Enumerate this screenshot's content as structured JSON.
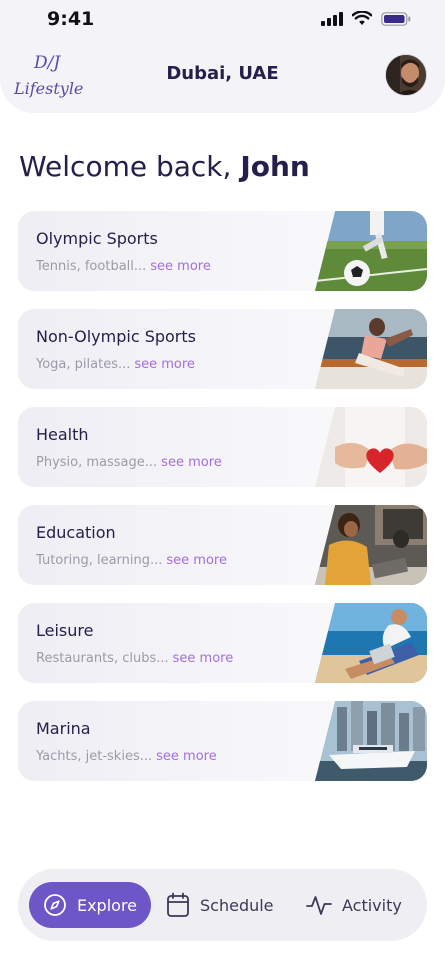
{
  "status": {
    "time": "9:41"
  },
  "header": {
    "logo_text_top": "D/J",
    "logo_text": "Lifestyle",
    "location": "Dubai, UAE"
  },
  "welcome": {
    "greeting": "Welcome back, ",
    "name": "John"
  },
  "see_more_label": "see more",
  "categories": [
    {
      "title": "Olympic Sports",
      "subtitle": "Tennis, football...",
      "image": "soccer-photo"
    },
    {
      "title": "Non-Olympic Sports",
      "subtitle": "Yoga, pilates...",
      "image": "yoga-photo"
    },
    {
      "title": "Health",
      "subtitle": "Physio, massage...",
      "image": "heart-hands-photo"
    },
    {
      "title": "Education",
      "subtitle": "Tutoring, learning...",
      "image": "students-photo"
    },
    {
      "title": "Leisure",
      "subtitle": "Restaurants, clubs...",
      "image": "beach-photo"
    },
    {
      "title": "Marina",
      "subtitle": "Yachts, jet-skies...",
      "image": "yacht-photo"
    }
  ],
  "nav": {
    "items": [
      {
        "label": "Explore",
        "icon": "compass-icon",
        "active": true
      },
      {
        "label": "Schedule",
        "icon": "calendar-icon",
        "active": false
      },
      {
        "label": "Activity",
        "icon": "activity-icon",
        "active": false
      }
    ]
  },
  "colors": {
    "accent": "#6c56c8",
    "see_more": "#a46fdc",
    "text": "#25204b"
  }
}
